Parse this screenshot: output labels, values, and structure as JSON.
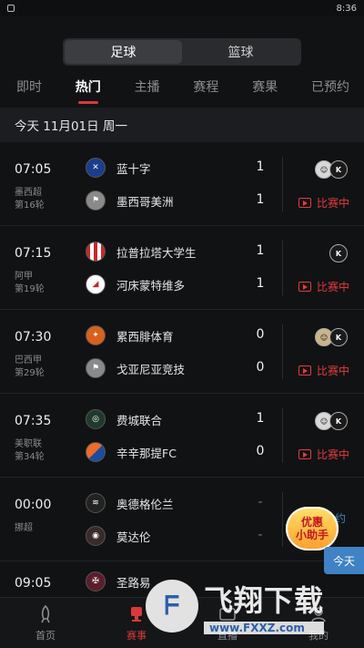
{
  "status": {
    "time": "8:36"
  },
  "sport_tabs": [
    {
      "label": "足球"
    },
    {
      "label": "篮球"
    }
  ],
  "sub_tabs": [
    {
      "label": "即时"
    },
    {
      "label": "热门"
    },
    {
      "label": "主播"
    },
    {
      "label": "赛程"
    },
    {
      "label": "赛果"
    },
    {
      "label": "已预约"
    }
  ],
  "date_label": "今天 11月01日 周一",
  "live_label": "比赛中",
  "matches": [
    {
      "time": "07:05",
      "league": "墨西超",
      "round": "第16轮",
      "home": "蓝十字",
      "away": "墨西哥美洲",
      "home_score": "1",
      "away_score": "1"
    },
    {
      "time": "07:15",
      "league": "阿甲",
      "round": "第19轮",
      "home": "拉普拉塔大学生",
      "away": "河床蒙特维多",
      "home_score": "1",
      "away_score": "1"
    },
    {
      "time": "07:30",
      "league": "巴西甲",
      "round": "第29轮",
      "home": "累西腓体育",
      "away": "戈亚尼亚竞技",
      "home_score": "0",
      "away_score": "0"
    },
    {
      "time": "07:35",
      "league": "美职联",
      "round": "第34轮",
      "home": "费城联合",
      "away": "辛辛那提FC",
      "home_score": "1",
      "away_score": "0"
    },
    {
      "time": "00:00",
      "league": "挪超",
      "round": "",
      "home": "奥德格伦兰",
      "away": "莫达伦",
      "home_score": "-",
      "away_score": "-"
    },
    {
      "time": "09:05",
      "league": "",
      "round": "",
      "home": "圣路易",
      "away": "",
      "home_score": "",
      "away_score": ""
    }
  ],
  "bottom_nav": [
    {
      "label": "首页"
    },
    {
      "label": "赛事"
    },
    {
      "label": "直播"
    },
    {
      "label": "我的"
    }
  ],
  "promo": {
    "line1": "优惠",
    "line2": "小助手"
  },
  "side_tab": "今天",
  "side_yue": "约",
  "watermark": {
    "brand": "飞翔下载",
    "url": "www.FXXZ.com"
  },
  "colors": {
    "accent": "#d83a3a",
    "background": "#111214",
    "blue": "#3f82c5"
  }
}
